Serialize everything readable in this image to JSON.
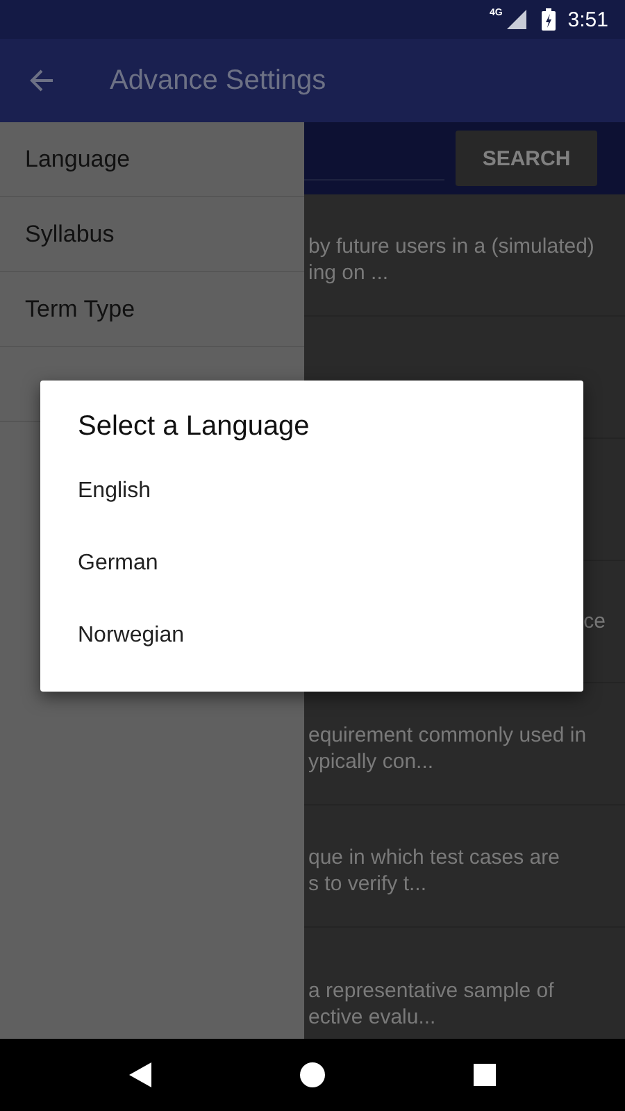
{
  "status_bar": {
    "network": "4G",
    "time": "3:51"
  },
  "app_bar": {
    "title": "Advance Settings"
  },
  "search": {
    "button": "SEARCH"
  },
  "list": [
    {
      "kind": "text",
      "lines": [
        "by future users in a (simulated)",
        "ing on ..."
      ]
    },
    {
      "kind": "blank"
    },
    {
      "kind": "blank"
    },
    {
      "kind": "partial",
      "lines": [
        "ce"
      ]
    },
    {
      "kind": "text",
      "lines": [
        "equirement commonly used in",
        "ypically con..."
      ]
    },
    {
      "kind": "text",
      "lines": [
        "que in which test cases are",
        "s to verify t..."
      ]
    },
    {
      "kind": "text",
      "lines": [
        "a representative sample of",
        "ective evalu..."
      ]
    }
  ],
  "drawer": {
    "items": [
      {
        "label": "Language"
      },
      {
        "label": "Syllabus"
      },
      {
        "label": "Term Type"
      }
    ]
  },
  "dialog": {
    "title": "Select a Language",
    "options": [
      {
        "label": "English"
      },
      {
        "label": "German"
      },
      {
        "label": "Norwegian"
      }
    ]
  }
}
